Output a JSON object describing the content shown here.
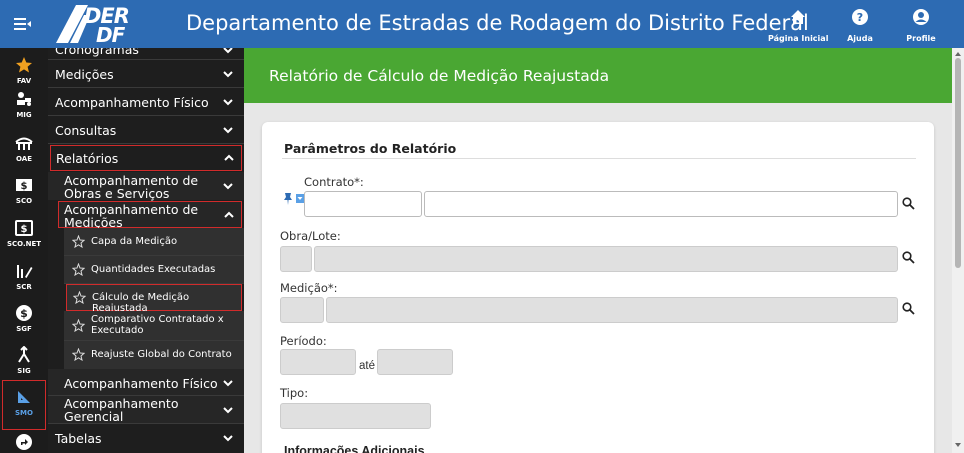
{
  "header": {
    "title": "Departamento de Estradas de Rodagem do Distrito Federal",
    "logo": {
      "line1": "DER",
      "line2": "DF"
    },
    "buttons": [
      {
        "label": "Página Inicial",
        "icon": "home-icon"
      },
      {
        "label": "Ajuda",
        "icon": "help-icon"
      },
      {
        "label": "Profile",
        "icon": "user-icon"
      }
    ],
    "menu_icon": "hamburger-icon"
  },
  "rail": [
    {
      "label": "FAV",
      "icon": "star-icon"
    },
    {
      "label": "MIG",
      "icon": "truck-icon"
    },
    {
      "label": "OAE",
      "icon": "bridge-icon"
    },
    {
      "label": "SCO",
      "icon": "money-icon"
    },
    {
      "label": "SCO.NET",
      "icon": "money-box-icon"
    },
    {
      "label": "SCR",
      "icon": "chart-pencil-icon"
    },
    {
      "label": "SGF",
      "icon": "dollar-circle-icon"
    },
    {
      "label": "SIG",
      "icon": "fork-icon"
    },
    {
      "label": "SMO",
      "icon": "ruler-triangle-icon",
      "active": true
    },
    {
      "label": "",
      "icon": "direction-icon"
    }
  ],
  "sidebar": {
    "partial_top": "Cronogramas",
    "items": [
      {
        "label": "Medições"
      },
      {
        "label": "Acompanhamento Físico"
      },
      {
        "label": "Consultas"
      },
      {
        "label": "Relatórios",
        "expanded": true
      }
    ],
    "relatorios_children": [
      {
        "label": "Acompanhamento de Obras e Serviços"
      },
      {
        "label": "Acompanhamento de Medições",
        "expanded": true
      }
    ],
    "medicoes_children": [
      {
        "label": "Capa da Medição"
      },
      {
        "label": "Quantidades Executadas"
      },
      {
        "label": "Cálculo de Medição Reajustada",
        "selected": true
      },
      {
        "label": "Comparativo Contratado x Executado"
      },
      {
        "label": "Reajuste Global do Contrato"
      }
    ],
    "after_children": [
      {
        "label": "Acompanhamento Físico"
      },
      {
        "label": "Acompanhamento Gerencial"
      }
    ],
    "bottom": {
      "label": "Tabelas"
    }
  },
  "main": {
    "banner_title": "Relatório de Cálculo de Medição Reajustada",
    "section_title": "Parâmetros do Relatório",
    "fields": {
      "contrato": {
        "label": "Contrato*:",
        "code": "",
        "name": ""
      },
      "obra": {
        "label": "Obra/Lote:",
        "code": "",
        "name": ""
      },
      "medicao": {
        "label": "Medição*:",
        "code": "",
        "name": ""
      },
      "periodo": {
        "label": "Período:",
        "from": "",
        "to": "",
        "separator": "até"
      },
      "tipo": {
        "label": "Tipo:",
        "value": ""
      }
    },
    "partial_section": "Informações Adicionais"
  },
  "colors": {
    "header": "#2d6bb3",
    "banner": "#4aa733",
    "sidebar": "#1e1e1e",
    "highlight": "#d12b2b"
  }
}
